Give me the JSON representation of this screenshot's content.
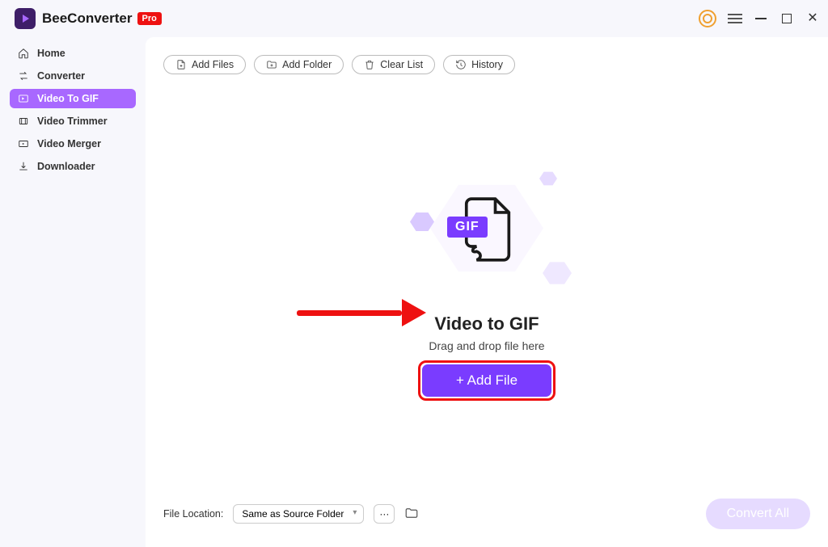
{
  "brand": {
    "name": "BeeConverter",
    "badge": "Pro"
  },
  "sidebar": {
    "items": [
      {
        "label": "Home"
      },
      {
        "label": "Converter"
      },
      {
        "label": "Video To GIF"
      },
      {
        "label": "Video Trimmer"
      },
      {
        "label": "Video Merger"
      },
      {
        "label": "Downloader"
      }
    ]
  },
  "toolbar": {
    "add_files": "Add Files",
    "add_folder": "Add Folder",
    "clear_list": "Clear List",
    "history": "History"
  },
  "drop": {
    "gif_badge": "GIF",
    "title": "Video to GIF",
    "subtitle": "Drag and drop file here",
    "add_button": "+ Add File"
  },
  "footer": {
    "location_label": "File Location:",
    "location_value": "Same as Source Folder",
    "more": "···",
    "convert": "Convert All"
  }
}
